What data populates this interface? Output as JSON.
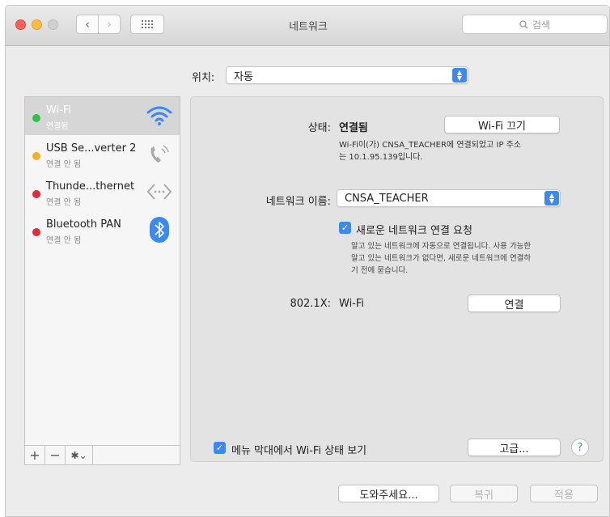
{
  "window": {
    "title": "네트워크"
  },
  "toolbar": {
    "search_placeholder": "검색"
  },
  "location": {
    "label": "위치:",
    "value": "자동"
  },
  "services": [
    {
      "name": "Wi-Fi",
      "status": "연결됨",
      "dot_color": "#2fc24a",
      "icon": "wifi-icon",
      "selected": true
    },
    {
      "name": "USB Se...verter 2",
      "status": "연결 안 됨",
      "dot_color": "#f5b026",
      "icon": "phone-icon",
      "selected": false
    },
    {
      "name": "Thunde...thernet",
      "status": "연결 안 됨",
      "dot_color": "#e6293a",
      "icon": "ethernet-icon",
      "selected": false
    },
    {
      "name": "Bluetooth PAN",
      "status": "연결 안 됨",
      "dot_color": "#e6293a",
      "icon": "bluetooth-icon",
      "selected": false
    }
  ],
  "sidebar_controls": {
    "add": "+",
    "remove": "−",
    "gear": "✱⌄"
  },
  "detail": {
    "status_label": "상태:",
    "status_value": "연결됨",
    "wifi_off_button": "Wi-Fi 끄기",
    "status_desc_1": "Wi-Fi이(가) CNSA_TEACHER에 연결되었고 IP 주소",
    "status_desc_2": "는 10.1.95.139입니다.",
    "network_name_label": "네트워크 이름:",
    "network_name_value": "CNSA_TEACHER",
    "ask_join_label": "새로운 네트워크 연결 요청",
    "ask_join_desc_1": "알고 있는 네트워크에 자동으로 연결됩니다. 사용 가능한",
    "ask_join_desc_2": "알고 있는 네트워크가 없다면, 새로운 네트워크에 연결하",
    "ask_join_desc_3": "기 전에 묻습니다.",
    "dot1x_label": "802.1X:",
    "dot1x_value": "Wi-Fi",
    "connect_button": "연결",
    "show_in_menu_label": "메뉴 막대에서 Wi-Fi 상태 보기",
    "advanced_button": "고급...",
    "help": "?"
  },
  "footer": {
    "assist": "도와주세요...",
    "revert": "복귀",
    "apply": "적용"
  },
  "colors": {
    "accent": "#3c89f2",
    "selection": "#d6d6d6"
  }
}
